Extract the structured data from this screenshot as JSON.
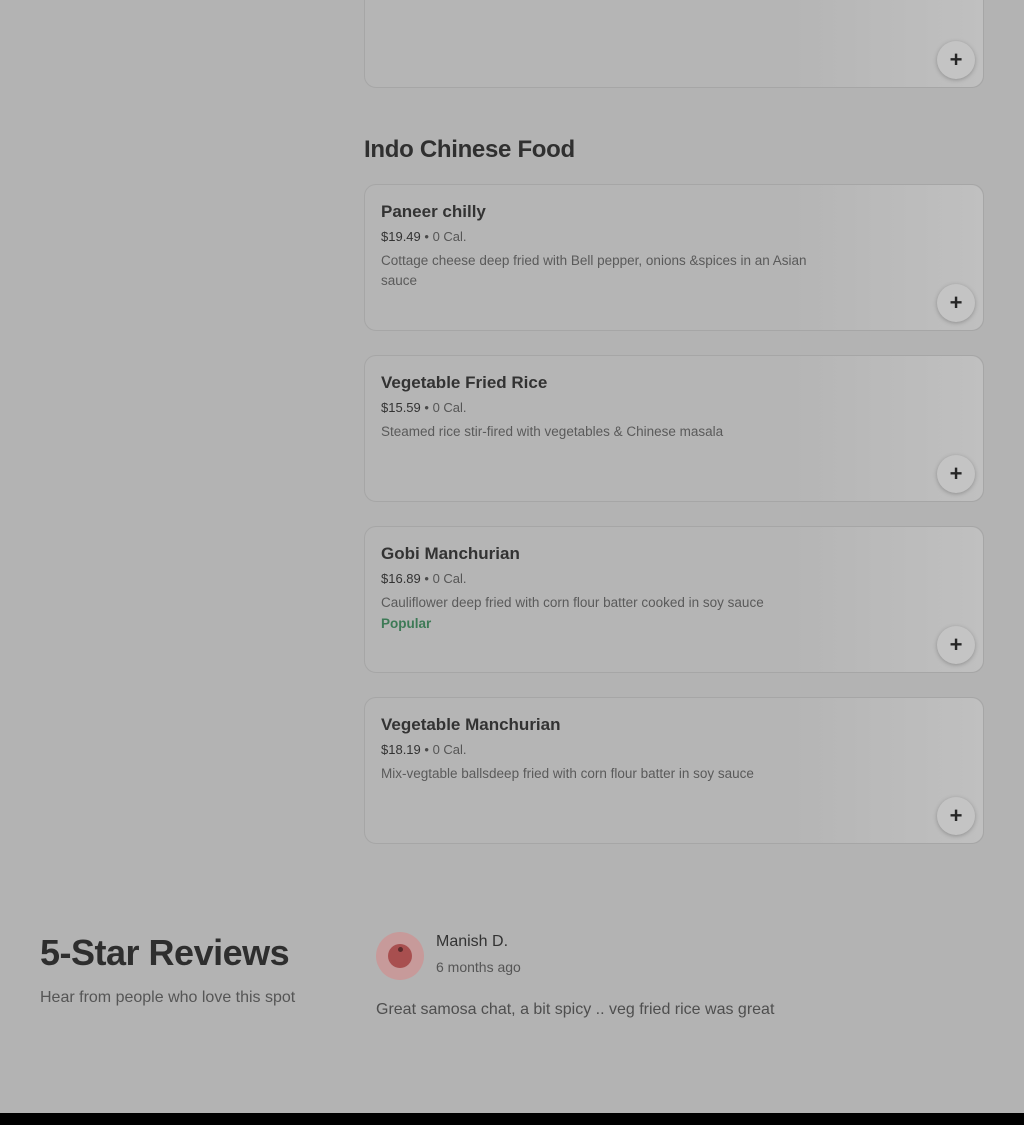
{
  "add_button_symbol": "+",
  "section": {
    "title": "Indo Chinese Food"
  },
  "items": [
    {
      "name": "Paneer chilly",
      "price": "$19.49",
      "separator": "•",
      "calories": "0 Cal.",
      "description": "Cottage cheese deep fried with Bell pepper, onions &spices in an Asian sauce",
      "badge": ""
    },
    {
      "name": "Vegetable Fried Rice",
      "price": "$15.59",
      "separator": "•",
      "calories": "0 Cal.",
      "description": "Steamed rice stir-fired with vegetables & Chinese masala",
      "badge": ""
    },
    {
      "name": "Gobi Manchurian",
      "price": "$16.89",
      "separator": "•",
      "calories": "0 Cal.",
      "description": "Cauliflower deep fried with corn flour batter cooked in soy sauce",
      "badge": "Popular"
    },
    {
      "name": "Vegetable Manchurian",
      "price": "$18.19",
      "separator": "•",
      "calories": "0 Cal.",
      "description": "Mix-vegtable ballsdeep fried with corn flour batter in soy sauce",
      "badge": ""
    }
  ],
  "reviews": {
    "title": "5-Star Reviews",
    "subtitle": "Hear from people who love this spot",
    "entries": [
      {
        "name": "Manish D.",
        "time": "6 months ago",
        "text": "Great samosa chat, a bit spicy .. veg fried rice was great"
      }
    ]
  },
  "colors": {
    "background": "#b3b3b3",
    "popular_badge": "#3d7a56",
    "footer": "#000000"
  },
  "icons": {
    "add": "plus-icon",
    "avatar": "user-avatar"
  }
}
